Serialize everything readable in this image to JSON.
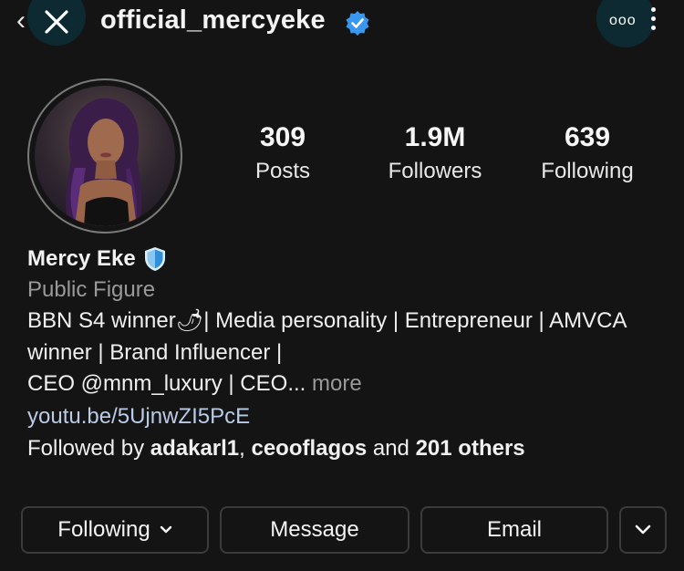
{
  "header": {
    "username": "official_mercyeke",
    "back_glyph": "‹",
    "more_dots": "ooo"
  },
  "stats": [
    {
      "value": "309",
      "label": "Posts"
    },
    {
      "value": "1.9M",
      "label": "Followers"
    },
    {
      "value": "639",
      "label": "Following"
    }
  ],
  "profile": {
    "name": "Mercy Eke",
    "category": "Public Figure",
    "bio_line1": "BBN S4 winner🌶| Media personality | Entrepreneur | AMVCA",
    "bio_line2": "winner | Brand Influencer |",
    "bio_line3": "CEO @mnm_luxury | CEO...",
    "more_label": " more",
    "link": "youtu.be/5UjnwZI5PcE",
    "followed_prefix": "Followed by ",
    "followed_user1": "adakarl1",
    "followed_sep": ", ",
    "followed_user2": "ceooflagos",
    "followed_and": " and ",
    "followed_others": "201 others"
  },
  "buttons": {
    "following": "Following",
    "message": "Message",
    "email": "Email"
  },
  "colors": {
    "background": "#141414",
    "verified_blue": "#3897f0",
    "link": "#b9cbe6",
    "muted": "#9a9a9a"
  }
}
